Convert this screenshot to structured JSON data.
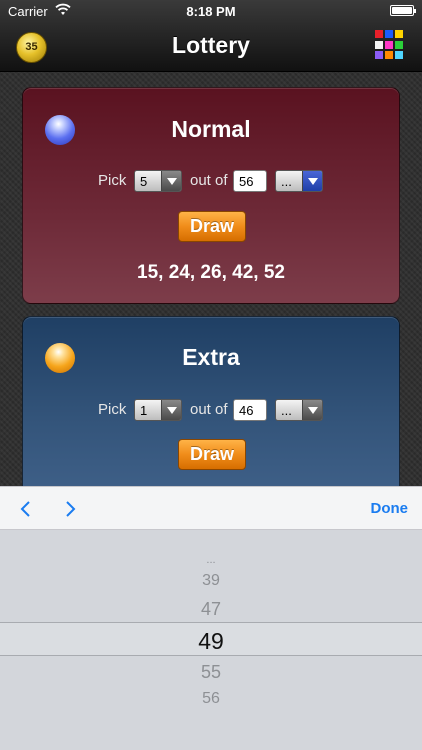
{
  "status_bar": {
    "carrier": "Carrier",
    "time": "8:18 PM"
  },
  "nav": {
    "title": "Lottery",
    "coin_count": "35"
  },
  "menu_grid_colors": [
    "#e8202a",
    "#1a5cff",
    "#ffd400",
    "#f4f4f4",
    "#ff39c8",
    "#2bd13a",
    "#8b5cf6",
    "#ff8a00",
    "#4fd6ff"
  ],
  "normal": {
    "title": "Normal",
    "pick_label": "Pick",
    "pick_value": "5",
    "out_of_label": "out of",
    "out_of_value": "56",
    "range_value": "...",
    "draw_label": "Draw",
    "result": "15, 24, 26, 42, 52"
  },
  "extra": {
    "title": "Extra",
    "pick_label": "Pick",
    "pick_value": "1",
    "out_of_label": "out of",
    "out_of_value": "46",
    "range_value": "...",
    "draw_label": "Draw"
  },
  "accessory": {
    "done_label": "Done"
  },
  "picker": {
    "options": [
      "...",
      "39",
      "47",
      "49",
      "55",
      "56"
    ],
    "selected": "49"
  }
}
